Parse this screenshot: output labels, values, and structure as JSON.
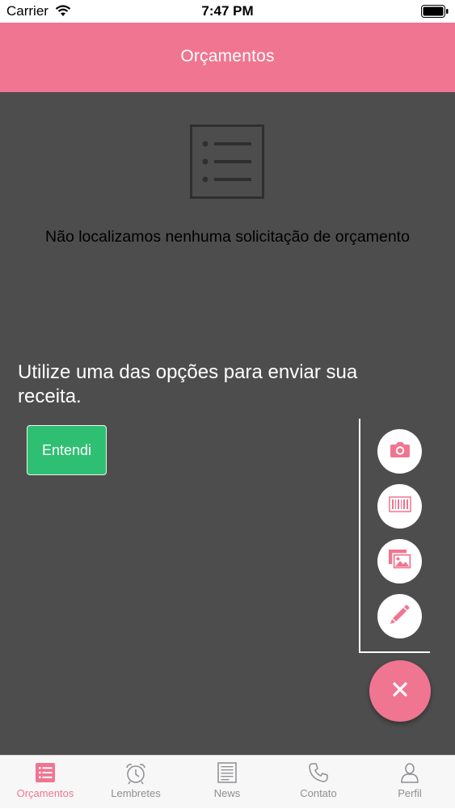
{
  "status_bar": {
    "carrier": "Carrier",
    "time": "7:47 PM"
  },
  "header": {
    "title": "Orçamentos"
  },
  "main": {
    "empty_message": "Não localizamos nenhuma solicitação de orçamento",
    "hint": "Utilize uma das opções para enviar sua receita.",
    "ok_button": "Entendi",
    "fab_actions": [
      "camera-icon",
      "barcode-icon",
      "gallery-icon",
      "pencil-icon"
    ],
    "fab_main": "close-icon"
  },
  "tab_bar": {
    "items": [
      {
        "label": "Orçamentos",
        "icon": "list-icon",
        "active": true
      },
      {
        "label": "Lembretes",
        "icon": "alarm-clock-icon",
        "active": false
      },
      {
        "label": "News",
        "icon": "news-icon",
        "active": false
      },
      {
        "label": "Contato",
        "icon": "phone-icon",
        "active": false
      },
      {
        "label": "Perfil",
        "icon": "user-icon",
        "active": false
      }
    ]
  },
  "colors": {
    "accent": "#f07591",
    "overlay": "#4d4d4d",
    "button_green": "#2ebf72",
    "tab_inactive": "#8e8e93"
  }
}
